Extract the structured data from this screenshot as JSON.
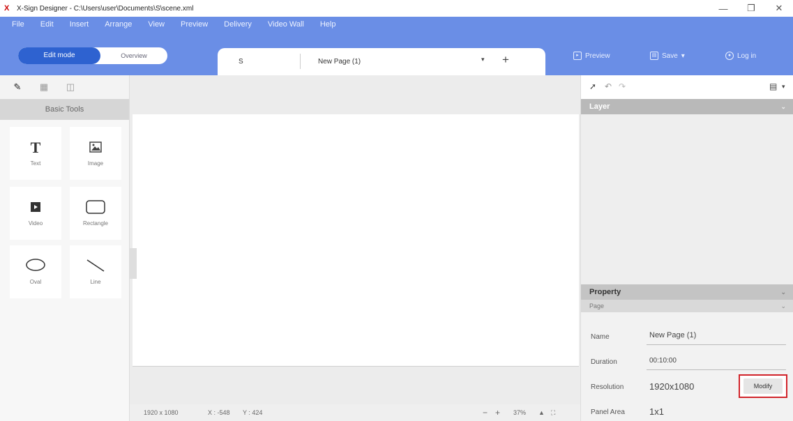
{
  "window": {
    "title": "X-Sign Designer - C:\\Users\\user\\Documents\\S\\scene.xml",
    "app_icon": "X",
    "minimize": "—",
    "maximize": "❐",
    "close": "✕"
  },
  "menu": [
    "File",
    "Edit",
    "Insert",
    "Arrange",
    "View",
    "Preview",
    "Delivery",
    "Video Wall",
    "Help"
  ],
  "toolbar": {
    "mode_active": "Edit mode",
    "mode_inactive": "Overview",
    "tab_scene": "S",
    "tab_page": "New Page (1)",
    "tab_dropdown": "▾",
    "tab_add": "+",
    "preview_label": "Preview",
    "save_label": "Save",
    "save_dropdown": "▾",
    "login_label": "Log in"
  },
  "left_panel": {
    "title": "Basic Tools",
    "tools": [
      {
        "label": "Text",
        "icon": "text-icon"
      },
      {
        "label": "Image",
        "icon": "image-icon"
      },
      {
        "label": "Video",
        "icon": "video-icon"
      },
      {
        "label": "Rectangle",
        "icon": "rectangle-icon"
      },
      {
        "label": "Oval",
        "icon": "oval-icon"
      },
      {
        "label": "Line",
        "icon": "line-icon"
      }
    ]
  },
  "statusbar": {
    "resolution": "1920 x 1080",
    "x": "X : -548",
    "y": "Y : 424",
    "zoom_out": "−",
    "zoom_in": "+",
    "zoom": "37%",
    "zoom_up": "▲",
    "fit": "⛶"
  },
  "right_panel": {
    "layer_title": "Layer",
    "property_title": "Property",
    "page_section": "Page",
    "chevron": "⌄",
    "props": {
      "name_label": "Name",
      "name_value": "New Page (1)",
      "duration_label": "Duration",
      "duration_value": "00:10:00",
      "resolution_label": "Resolution",
      "resolution_value": "1920x1080",
      "modify_label": "Modify",
      "panel_label": "Panel Area",
      "panel_value": "1x1"
    }
  },
  "colors": {
    "accent": "#6a8ee6",
    "accent_dark": "#2e62d0",
    "highlight": "#d1232a"
  }
}
